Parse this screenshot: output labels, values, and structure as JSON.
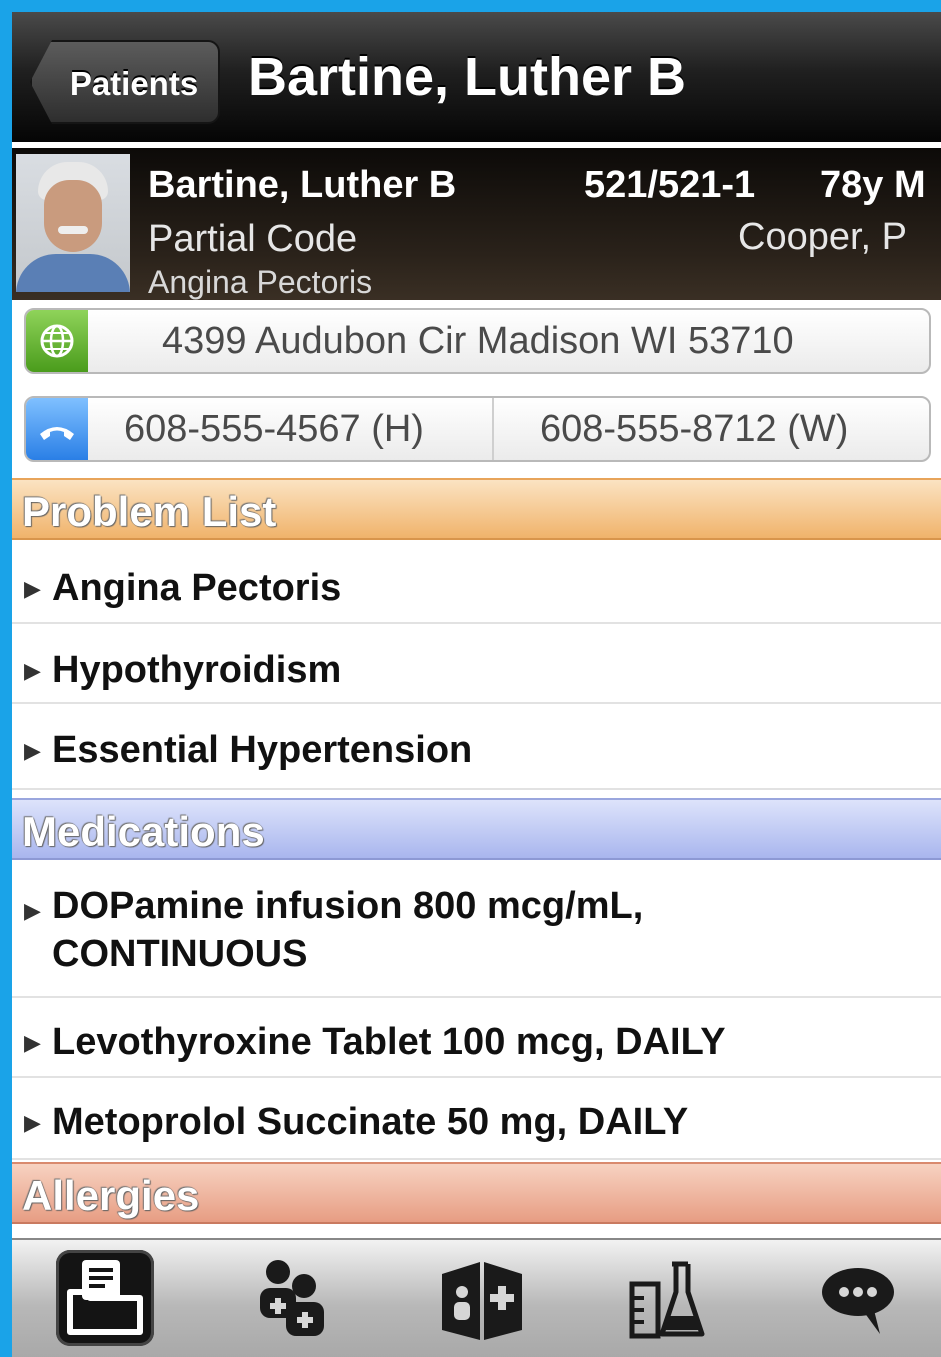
{
  "nav": {
    "back_label": "Patients",
    "title": "Bartine, Luther B"
  },
  "patient": {
    "name": "Bartine, Luther B",
    "room": "521/521-1",
    "age_sex": "78y M",
    "code_status": "Partial Code",
    "doctor": "Cooper, P",
    "diagnosis": "Angina Pectoris"
  },
  "contact": {
    "address": "4399 Audubon Cir  Madison WI 53710",
    "phone_home": "608-555-4567 (H)",
    "phone_work": "608-555-8712 (W)"
  },
  "sections": {
    "problems": {
      "title": "Problem List",
      "items": [
        "Angina Pectoris",
        "Hypothyroidism",
        "Essential Hypertension"
      ]
    },
    "medications": {
      "title": "Medications",
      "items": [
        "DOPamine infusion 800 mcg/mL, CONTINUOUS",
        "Levothyroxine Tablet 100 mcg, DAILY",
        "Metoprolol Succinate 50 mg, DAILY"
      ]
    },
    "allergies": {
      "title": "Allergies"
    }
  },
  "tabs": [
    {
      "icon": "chart-icon",
      "selected": true
    },
    {
      "icon": "care-team-icon",
      "selected": false
    },
    {
      "icon": "hospital-icon",
      "selected": false
    },
    {
      "icon": "lab-results-icon",
      "selected": false
    },
    {
      "icon": "messages-icon",
      "selected": false
    }
  ],
  "colors": {
    "frame": "#1aa3e8",
    "problem_header": "#f0b36b",
    "medications_header": "#a9b6ee",
    "allergies_header": "#e79d83"
  }
}
